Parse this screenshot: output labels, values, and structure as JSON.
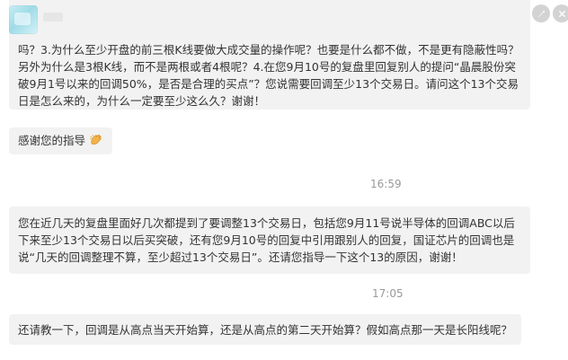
{
  "header": {
    "edit_icon": "edit-icon",
    "close_icon": "close-icon"
  },
  "messages": [
    {
      "id": "m1",
      "text": "吗？3.为什么至少开盘的前三根K线要做大成交量的操作呢？也要是什么都不做，不是更有隐蔽性吗？另外为什么是3根K线，而不是两根或者4根呢？4.在您9月10号的复盘里回复别人的提问“晶晨股份突破9月1号以来的回调50%，是否是合理的买点”？您说需要回调至少13个交易日。请问这个13个交易日是怎么来的，为什么一定要至少这么久？谢谢！"
    },
    {
      "id": "m2",
      "text": "感谢您的指导",
      "emoji": "clap-hands-icon"
    },
    {
      "id": "m3",
      "timestamp": "16:59",
      "text": "您在近几天的复盘里面好几次都提到了要调整13个交易日，包括您9月11号说半导体的回调ABC以后下来至少13个交易日以后买突破，还有您9月10号的回复中引用跟别人的回复，国证芯片的回调也是说“几天的回调整理不算，至少超过13个交易日”。还请您指导一下这个13的原因，谢谢！"
    },
    {
      "id": "m4",
      "timestamp": "17:05",
      "text": "还请教一下，回调是从高点当天开始算，还是从高点的第二天开始算？假如高点那一天是长阳线呢？"
    }
  ],
  "colors": {
    "bubble": "#f2f2f2",
    "text": "#333333",
    "timestamp": "#9a9a9a"
  }
}
